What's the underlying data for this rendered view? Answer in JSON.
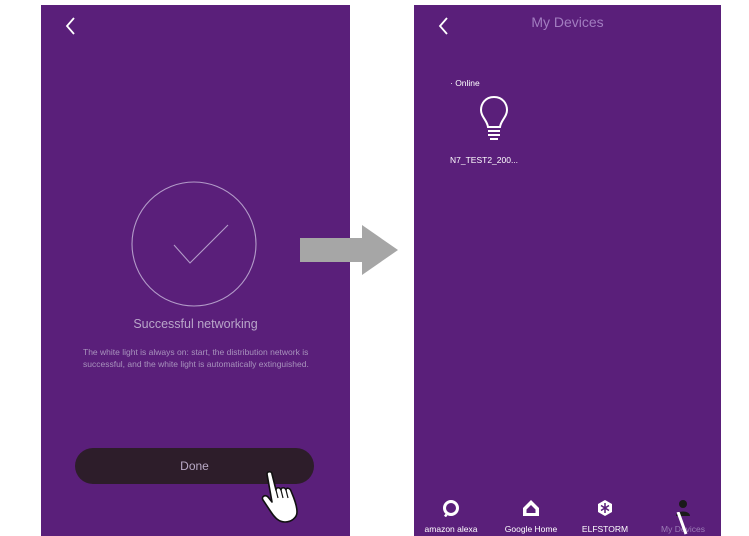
{
  "left_screen": {
    "back_icon": "chevron-left-icon",
    "success_title": "Successful networking",
    "description": "The white light is always on: start, the distribution network is successful, and the white light is automatically extinguished.",
    "done_label": "Done"
  },
  "right_screen": {
    "title": "My Devices",
    "back_icon": "chevron-left-icon",
    "status_label": "· Online",
    "device": {
      "name": "N7_TEST2_200...",
      "icon": "lightbulb-icon"
    },
    "nav": [
      {
        "label": "amazon alexa",
        "icon": "alexa-icon"
      },
      {
        "label": "Google Home",
        "icon": "google-home-icon"
      },
      {
        "label": "ELFSTORM",
        "icon": "elfstorm-icon"
      },
      {
        "label": "My Devices",
        "icon": "user-icon"
      }
    ]
  },
  "colors": {
    "background": "#5a1f7a",
    "done_button": "#2d1d2a",
    "arrow": "#a6a6a6",
    "title_text": "#a27dc0"
  }
}
